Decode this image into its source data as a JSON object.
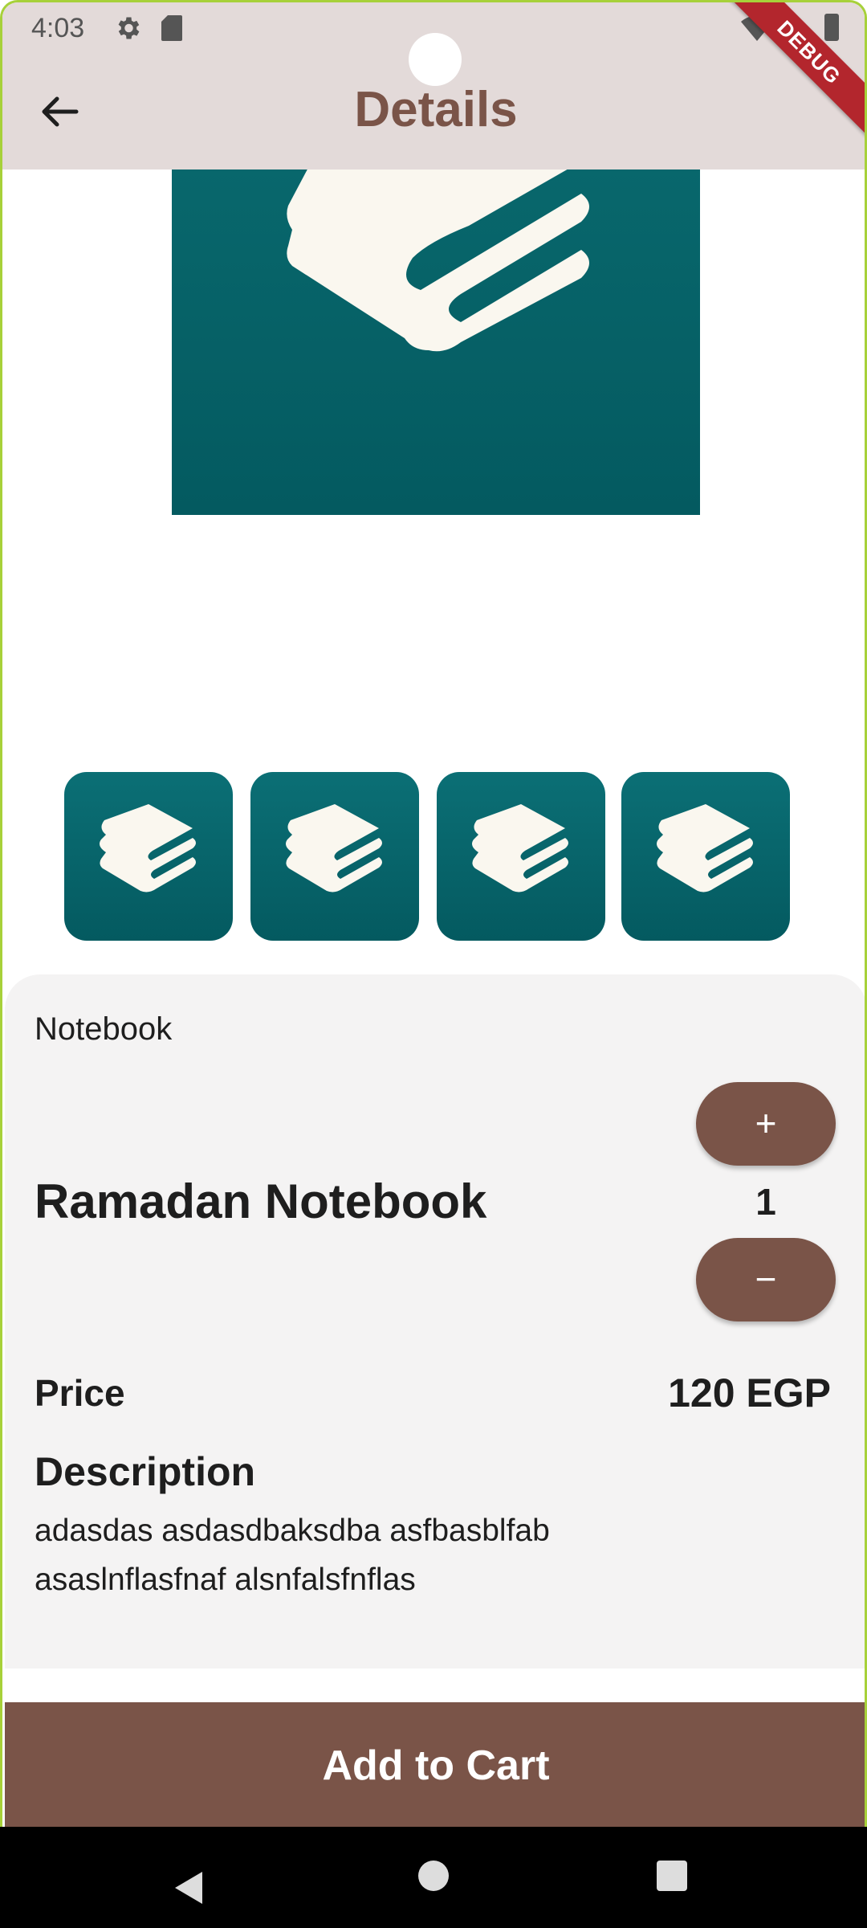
{
  "status_bar": {
    "time": "4:03",
    "extra": "2"
  },
  "debug_banner": "DEBUG",
  "app_bar": {
    "title": "Details"
  },
  "product": {
    "category": "Notebook",
    "name": "Ramadan Notebook",
    "quantity": "1",
    "plus_label": "+",
    "minus_label": "−",
    "price_label": "Price",
    "price": "120 EGP",
    "description_title": "Description",
    "description": "adasdas asdasdbaksdba asfbasblfab asaslnflasfnaf alsnfalsfnflas"
  },
  "thumbnails": [
    "notebook-logo",
    "notebook-logo",
    "notebook-logo",
    "notebook-logo"
  ],
  "cta": {
    "add_to_cart": "Add to Cart"
  },
  "colors": {
    "app_bar_bg": "#e3dad9",
    "brand_brown": "#7a5448",
    "image_teal": "#045a60",
    "card_bg": "#f4f3f3"
  }
}
